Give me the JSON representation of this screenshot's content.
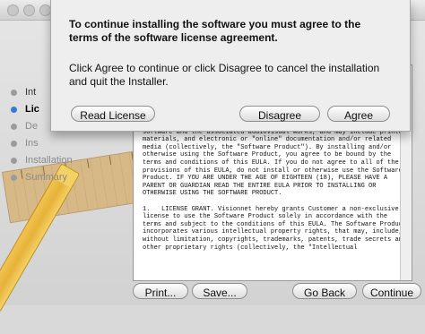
{
  "window": {
    "title_partial": "00("
  },
  "sidebar": {
    "steps": [
      {
        "label": "Int",
        "state": "done"
      },
      {
        "label": "Lic",
        "state": "current"
      },
      {
        "label": "De",
        "state": "todo"
      },
      {
        "label": "Ins",
        "state": "todo"
      },
      {
        "label": "Installation",
        "state": "todo"
      },
      {
        "label": "Summary",
        "state": "todo"
      }
    ]
  },
  "sheet": {
    "title": "To continue installing the software you must agree to the terms of the software license agreement.",
    "message": "Click Agree to continue or click Disagree to cancel the installation and quit the Installer.",
    "read_license_label": "Read License",
    "disagree_label": "Disagree",
    "agree_label": "Agree"
  },
  "license": {
    "text": "(collectively the \"Customer\"), which product includes computer software and the associated audiovisual works, and may include printed materials, and electronic or \"online\" documentation and/or related media (collectively, the \"Software Product\"). By installing and/or otherwise using the Software Product, you agree to be bound by the terms and conditions of this EULA. If you do not agree to all of the provisions of this EULA, do not install or otherwise use the Software Product. IF YOU ARE UNDER THE AGE OF EIGHTEEN (18), PLEASE HAVE A PARENT OR GUARDIAN READ THE ENTIRE EULA PRIOR TO INSTALLING OR OTHERWISE USING THE SOFTWARE PRODUCT.\n\n1.   LICENSE GRANT. Visionnet hereby grants Customer a non-exclusive license to use the Software Product solely in accordance with the terms and subject to the conditions of this EULA. The Software Product incorporates various intellectual property rights, that may, include, without limitation, copyrights, trademarks, patents, trade secrets and other proprietary rights (collectively, the \"Intellectual"
  },
  "footer": {
    "print_label": "Print...",
    "save_label": "Save...",
    "go_back_label": "Go Back",
    "continue_label": "Continue"
  },
  "colors": {
    "current_step": "#3a78d6",
    "window_bg": "#d9d9d9"
  }
}
